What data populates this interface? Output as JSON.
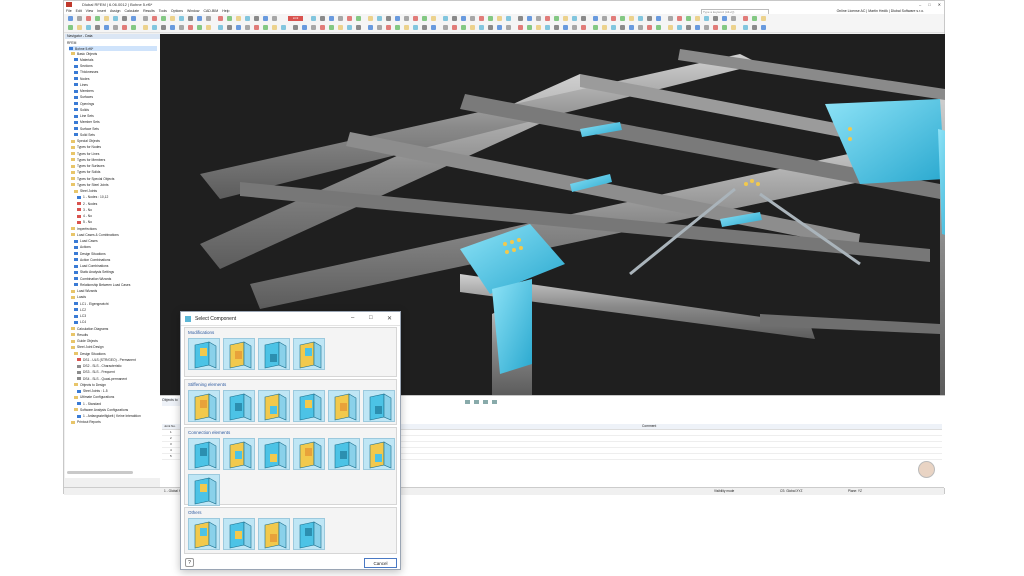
{
  "window": {
    "title": "Dlubal RFEM | 6.06.0012 | Bohne 5.rf6*",
    "controls": [
      "–",
      "□",
      "✕"
    ],
    "search_placeholder": "Type a keyword (Alt+Q)",
    "license": "Online License AC | Martin Hedik | Dlubal Software s.r.o."
  },
  "menu": [
    "File",
    "Edit",
    "View",
    "Insert",
    "Assign",
    "Calculate",
    "Results",
    "Tools",
    "Options",
    "Window",
    "CAD-BIM",
    "Help"
  ],
  "toolbar": {
    "load_case_badge": "LC2",
    "load_case_label": "LC2"
  },
  "navigator": {
    "title": "Navigator - Data",
    "root": "RFEM",
    "model": "Bohne 5.rf6*",
    "items": [
      "Basic Objects",
      "Materials",
      "Sections",
      "Thicknesses",
      "Nodes",
      "Lines",
      "Members",
      "Surfaces",
      "Openings",
      "Solids",
      "Line Sets",
      "Member Sets",
      "Surface Sets",
      "Solid Sets",
      "Special Objects",
      "Types for Nodes",
      "Types for Lines",
      "Types for Members",
      "Types for Surfaces",
      "Types for Solids",
      "Types for Special Objects",
      "Types for Steel Joints",
      "Steel Joints",
      "1 - Nodes : 10,12",
      "2 - Nodes",
      "3 - No",
      "4 - No",
      "5 - No",
      "Imperfections",
      "Load Cases & Combinations",
      "Load Cases",
      "Actions",
      "Design Situations",
      "Action Combinations",
      "Load Combinations",
      "Static Analysis Settings",
      "Combination Wizards",
      "Relationship Between Load Cases",
      "Load Wizards",
      "Loads",
      "LC1 - Eigengewicht",
      "LC2",
      "LC3",
      "LC4",
      "Calculation Diagrams",
      "Results",
      "Guide Objects",
      "Steel Joint Design",
      "Design Situations",
      "DS1 - ULS (STR/GEO) - Permanent",
      "DS2 - SLS - Characteristic",
      "DS3 - SLS - Frequent",
      "DS4 - SLS - Quasi-permanent",
      "Objects to Design",
      "Steel Joints : 1-5",
      "Ultimate Configurations",
      "1 - Standard",
      "Software Analysis Configurations",
      "1 - Anfangssteifigkeit | Keine Interaktion",
      "Printout Reports"
    ]
  },
  "bottom_panel": {
    "title": "Objects to",
    "col_header": "Comment",
    "rows": [
      "1",
      "2",
      "3",
      "4",
      "5"
    ],
    "row_header": "Joint No."
  },
  "statusbar": {
    "cs": "1 - Global XYZ",
    "visibility": "Visibility mode",
    "cs_right": "CS: Global XYZ",
    "plane": "Plane: YZ"
  },
  "dialog": {
    "title": "Select Component",
    "sections": [
      {
        "title": "Modifications",
        "items": [
          "end-plate-modification",
          "plate-cut",
          "member-cut",
          "plate-editor"
        ]
      },
      {
        "title": "Stiffening elements",
        "items": [
          "stiffener-a",
          "stiffener-b",
          "stiffener-c",
          "stiffener-d",
          "stiffener-e",
          "stiffener-f"
        ]
      },
      {
        "title": "Connection elements",
        "items": [
          "end-plate",
          "fin-plate",
          "bolted-plate",
          "web-cleat",
          "gusset-connection",
          "flange-splice",
          "base-plate"
        ]
      },
      {
        "title": "Others",
        "items": [
          "auxiliary-plane",
          "cutting-plane",
          "weld-component",
          "anchor-component"
        ]
      }
    ],
    "cancel": "Cancel",
    "help": "?"
  },
  "colors": {
    "accent": "#2d5aa0",
    "steel_blue": "#4cc3e6",
    "viewport_bg": "#1f1f1f",
    "bolt": "#f2c94c"
  }
}
